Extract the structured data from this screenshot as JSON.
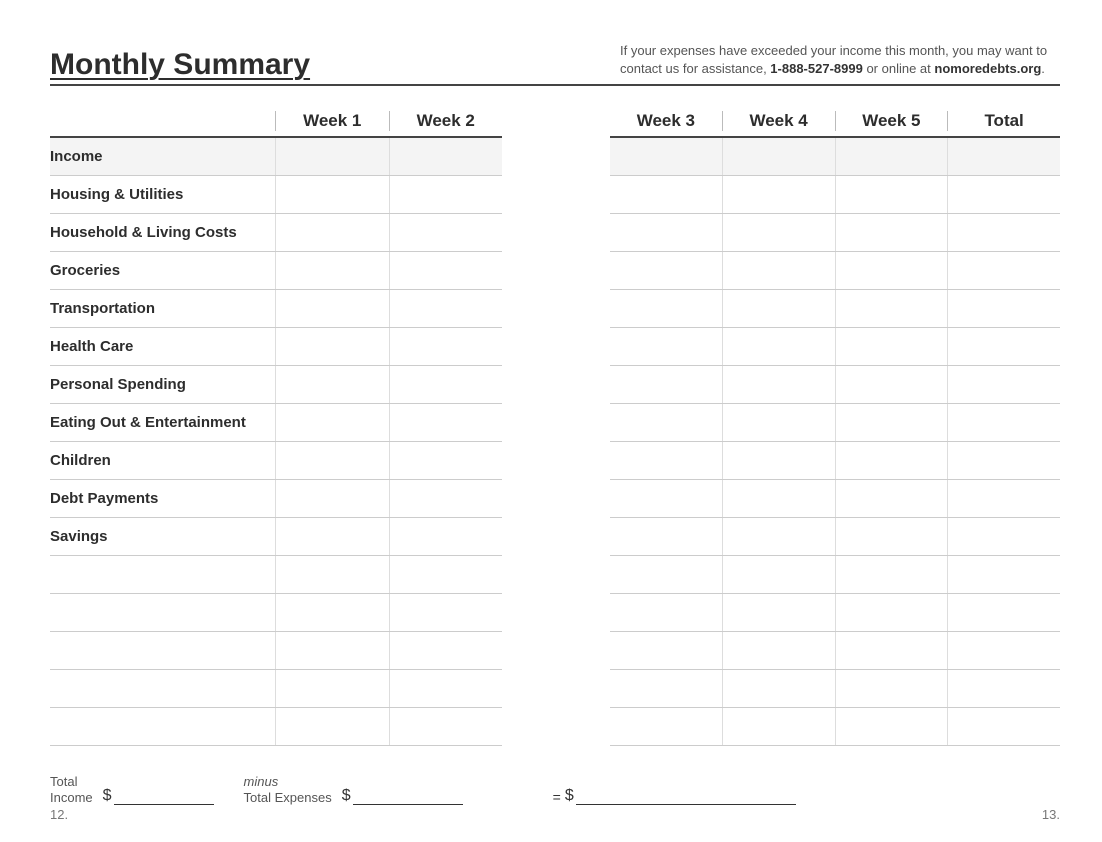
{
  "header": {
    "title": "Monthly Summary",
    "advice_pre": "If your expenses have exceeded your income this month, you may want to contact us for assistance, ",
    "advice_phone": "1-888-527-8999",
    "advice_mid": " or online at ",
    "advice_site": "nomoredebts.org",
    "advice_end": "."
  },
  "columns": {
    "w1": "Week 1",
    "w2": "Week 2",
    "w3": "Week 3",
    "w4": "Week 4",
    "w5": "Week 5",
    "total": "Total"
  },
  "categories": {
    "c0": "Income",
    "c1": "Housing & Utilities",
    "c2": "Household & Living Costs",
    "c3": "Groceries",
    "c4": "Transportation",
    "c5": "Health Care",
    "c6": "Personal Spending",
    "c7": "Eating Out & Entertainment",
    "c8": "Children",
    "c9": "Debt Payments",
    "c10": "Savings",
    "c11": "",
    "c12": "",
    "c13": "",
    "c14": "",
    "c15": ""
  },
  "footer": {
    "total_income_l1": "Total",
    "total_income_l2": "Income",
    "minus": "minus",
    "total_expenses": "Total Expenses",
    "dollar": "$",
    "equals": "="
  },
  "page_left": "12.",
  "page_right": "13."
}
